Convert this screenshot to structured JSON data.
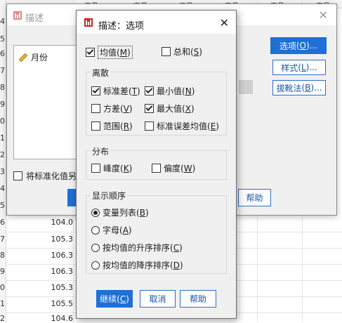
{
  "spreadsheet": {
    "col_header": "变量",
    "row_numbers": [
      "4",
      "5",
      "6",
      "7",
      "8",
      "9",
      "0",
      "1",
      "2",
      "3",
      "4",
      "5",
      "6",
      "7",
      "8",
      "9",
      "0",
      "1",
      "2",
      "3",
      "4"
    ],
    "cells": [
      "104.0",
      "105.3",
      "106.3",
      "106.3",
      "105.3",
      "105.5",
      "104.6"
    ]
  },
  "main_dialog": {
    "title": "描述",
    "variables": [
      {
        "label": "月份",
        "icon": "ruler-icon"
      }
    ],
    "standardize_label": "将标准化值另",
    "buttons": {
      "options": {
        "text": "选项",
        "key": "O",
        "suffix": "..."
      },
      "style": {
        "text": "样式",
        "key": "L",
        "suffix": "..."
      },
      "bootstrap": {
        "text": "拔靴法",
        "key": "B",
        "suffix": "..."
      },
      "help": "帮助"
    }
  },
  "options_dialog": {
    "title": "描述：选项",
    "mean": {
      "text": "均值",
      "key": "M",
      "checked": true
    },
    "sum": {
      "text": "总和",
      "key": "S",
      "checked": false
    },
    "dispersion": {
      "title": "离散",
      "std": {
        "text": "标准差",
        "key": "T",
        "checked": true
      },
      "min": {
        "text": "最小值",
        "key": "N",
        "checked": true
      },
      "variance": {
        "text": "方差",
        "key": "V",
        "checked": false
      },
      "max": {
        "text": "最大值",
        "key": "X",
        "checked": true
      },
      "range": {
        "text": "范围",
        "key": "R",
        "checked": false
      },
      "se_mean": {
        "text": "标准误差均值",
        "key": "E",
        "checked": false
      }
    },
    "distribution": {
      "title": "分布",
      "kurtosis": {
        "text": "峰度",
        "key": "K",
        "checked": false
      },
      "skewness": {
        "text": "偏度",
        "key": "W",
        "checked": false
      }
    },
    "display_order": {
      "title": "显示顺序",
      "selected": "variable_list",
      "options": [
        {
          "id": "variable_list",
          "text": "变量列表",
          "key": "B"
        },
        {
          "id": "alphabetic",
          "text": "字母",
          "key": "A"
        },
        {
          "id": "ascending",
          "text": "按均值的升序排序",
          "key": "C"
        },
        {
          "id": "descending",
          "text": "按均值的降序排序",
          "key": "D"
        }
      ]
    },
    "buttons": {
      "continue": {
        "text": "继续",
        "key": "C"
      },
      "cancel": "取消",
      "help": "帮助"
    }
  },
  "colors": {
    "accent": "#1f6fd6",
    "button_border": "#2e6fc4",
    "dialog_bg": "#f0f0f0"
  }
}
